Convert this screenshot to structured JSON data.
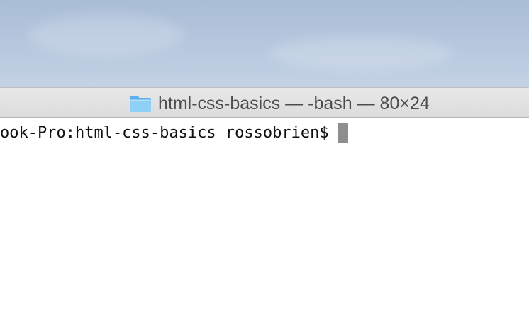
{
  "window": {
    "title": "html-css-basics — -bash — 80×24",
    "folder_icon": "folder-icon"
  },
  "terminal": {
    "prompt": "ook-Pro:html-css-basics rossobrien$"
  },
  "colors": {
    "desktop": "#b3c5dc",
    "titlebar": "#dcdcdc",
    "title_text": "#4d4d4d",
    "terminal_bg": "#ffffff",
    "terminal_text": "#111111",
    "cursor": "#8e8e8e",
    "folder": "#7ec3f2"
  }
}
